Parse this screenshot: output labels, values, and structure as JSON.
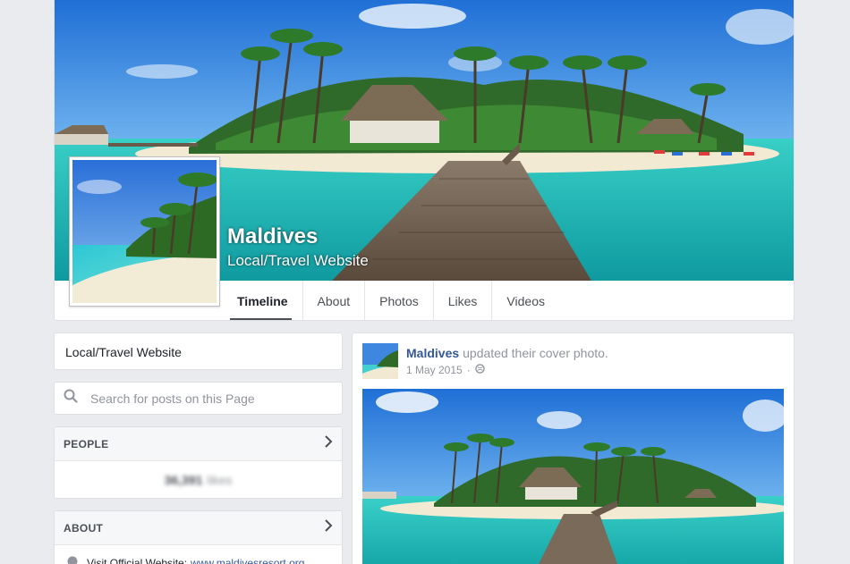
{
  "page": {
    "name": "Maldives",
    "category": "Local/Travel Website"
  },
  "tabs": [
    {
      "label": "Timeline",
      "active": true
    },
    {
      "label": "About",
      "active": false
    },
    {
      "label": "Photos",
      "active": false
    },
    {
      "label": "Likes",
      "active": false
    },
    {
      "label": "Videos",
      "active": false
    }
  ],
  "sidebar": {
    "category_text": "Local/Travel Website",
    "search_placeholder": "Search for posts on this Page",
    "people": {
      "title": "PEOPLE",
      "likes_count": "36,391",
      "likes_label": "likes"
    },
    "about": {
      "title": "ABOUT",
      "website_prefix": "Visit Official Website:",
      "website_link": "www.maldivesresort.org"
    }
  },
  "post": {
    "author": "Maldives",
    "action": "updated their cover photo.",
    "date": "1 May 2015",
    "separator": "·",
    "privacy_icon": "globe-icon"
  },
  "colors": {
    "link": "#365899",
    "background": "#e9ebee",
    "muted": "#90949c"
  }
}
